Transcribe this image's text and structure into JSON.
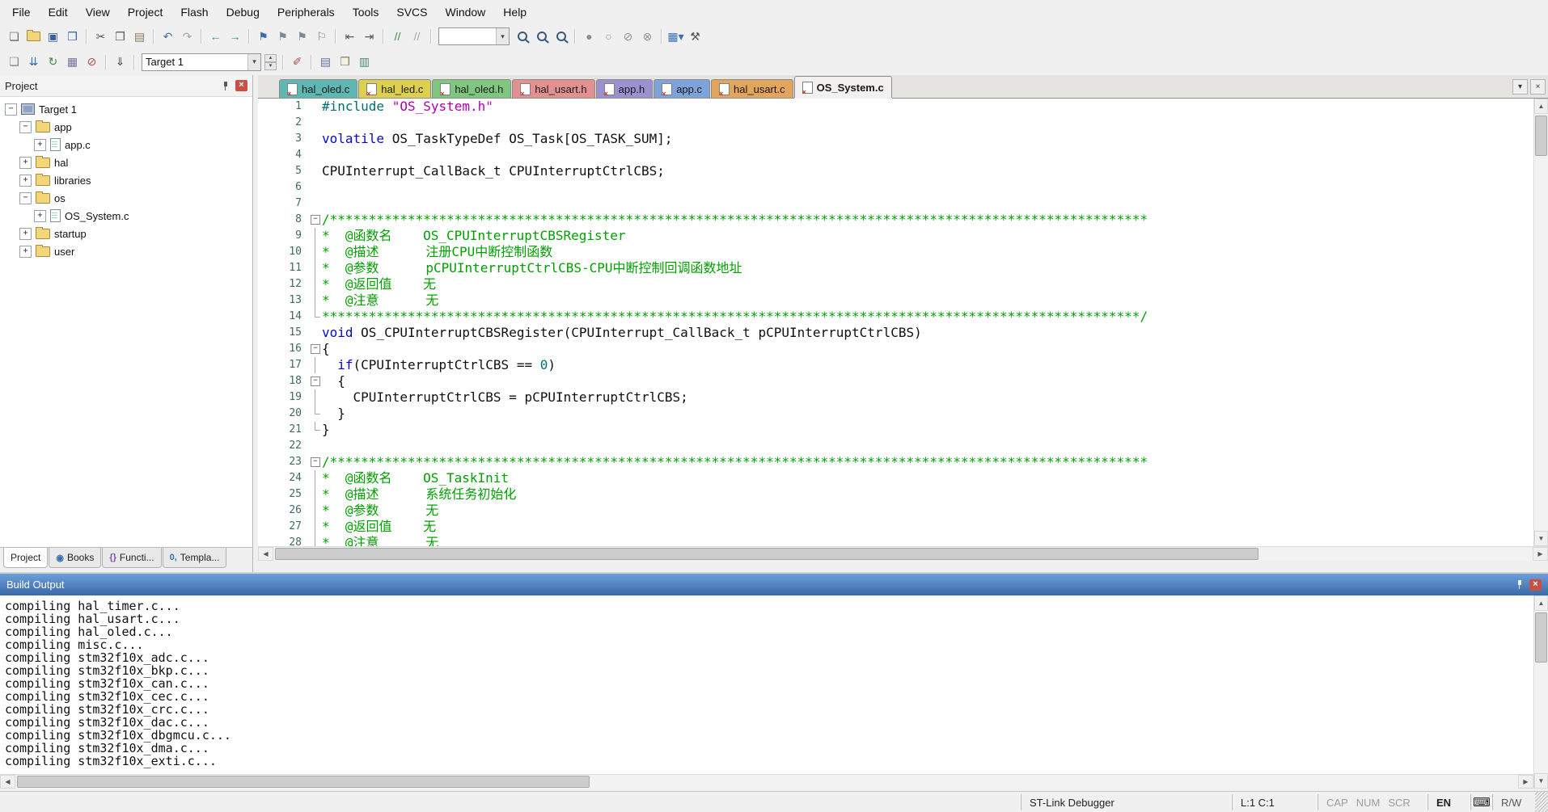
{
  "menubar": {
    "items": [
      "File",
      "Edit",
      "View",
      "Project",
      "Flash",
      "Debug",
      "Peripherals",
      "Tools",
      "SVCS",
      "Window",
      "Help"
    ]
  },
  "toolbar1": {
    "items": [
      {
        "name": "new-file-icon",
        "glyph": "❏",
        "color": "#5a6a7a"
      },
      {
        "name": "open-file-icon",
        "type": "folder"
      },
      {
        "name": "save-icon",
        "glyph": "▣",
        "color": "#3a5fa0"
      },
      {
        "name": "save-all-icon",
        "glyph": "❒",
        "color": "#3a5fa0"
      },
      {
        "type": "sep"
      },
      {
        "name": "cut-icon",
        "glyph": "✂",
        "color": "#555555"
      },
      {
        "name": "copy-icon",
        "glyph": "❐",
        "color": "#555555"
      },
      {
        "name": "paste-icon",
        "glyph": "▤",
        "color": "#8a7a5a"
      },
      {
        "type": "sep"
      },
      {
        "name": "undo-icon",
        "glyph": "↶",
        "color": "#3a6fb0"
      },
      {
        "name": "redo-icon",
        "glyph": "↷",
        "color": "#9aa4b0"
      },
      {
        "type": "sep"
      },
      {
        "name": "navigate-back-icon",
        "glyph": "←",
        "color": "#2a9a9a"
      },
      {
        "name": "navigate-forward-icon",
        "glyph": "→",
        "color": "#2a9a9a"
      },
      {
        "type": "sep"
      },
      {
        "name": "bookmark-toggle-icon",
        "glyph": "⚑",
        "color": "#3a6fb0"
      },
      {
        "name": "bookmark-prev-icon",
        "glyph": "⚑",
        "color": "#7a8a9a"
      },
      {
        "name": "bookmark-next-icon",
        "glyph": "⚑",
        "color": "#7a8a9a"
      },
      {
        "name": "bookmark-clear-icon",
        "glyph": "⚐",
        "color": "#7a8a9a"
      },
      {
        "type": "sep"
      },
      {
        "name": "unindent-icon",
        "glyph": "⇤",
        "color": "#555555"
      },
      {
        "name": "indent-icon",
        "glyph": "⇥",
        "color": "#555555"
      },
      {
        "type": "sep"
      },
      {
        "name": "comment-icon",
        "glyph": "//",
        "color": "#3a8a3a"
      },
      {
        "name": "uncomment-icon",
        "glyph": "//",
        "color": "#9aa6b0"
      },
      {
        "type": "sep"
      },
      {
        "type": "combo",
        "name": "quick-search-combo",
        "value": ""
      },
      {
        "name": "find-in-files-icon",
        "type": "mag"
      },
      {
        "name": "find-icon",
        "type": "mag"
      },
      {
        "name": "incremental-find-icon",
        "type": "mag"
      },
      {
        "type": "sep"
      },
      {
        "name": "insert-breakpoint-icon",
        "glyph": "●",
        "color": "#8f8f8f"
      },
      {
        "name": "enable-breakpoint-icon",
        "glyph": "○",
        "color": "#8f8f8f"
      },
      {
        "name": "disable-all-breakpoints-icon",
        "glyph": "⊘",
        "color": "#8f8f8f"
      },
      {
        "name": "kill-all-breakpoints-icon",
        "glyph": "⊗",
        "color": "#8f8f8f"
      },
      {
        "type": "sep"
      },
      {
        "name": "debug-windows-dropdown-icon",
        "glyph": "▦▾",
        "color": "#3a6fb0"
      },
      {
        "name": "configure-icon",
        "glyph": "⚒",
        "color": "#555555"
      }
    ]
  },
  "toolbar2": {
    "items": [
      {
        "name": "translate-file-icon",
        "glyph": "❏",
        "color": "#7a8a9a"
      },
      {
        "name": "build-icon",
        "glyph": "⇊",
        "color": "#3a6fb0"
      },
      {
        "name": "rebuild-all-icon",
        "glyph": "↻",
        "color": "#3a8a4a"
      },
      {
        "name": "batch-build-icon",
        "glyph": "▦",
        "color": "#7a6f9f"
      },
      {
        "name": "stop-build-icon",
        "glyph": "⊘",
        "color": "#b04848"
      },
      {
        "type": "sep"
      },
      {
        "name": "download-icon",
        "glyph": "⇓",
        "color": "#4a4a4a"
      },
      {
        "type": "sep"
      },
      {
        "type": "combo",
        "name": "target-select",
        "value": "Target 1",
        "wide": 146
      },
      {
        "type": "spin",
        "name": "target-spin"
      },
      {
        "type": "sep"
      },
      {
        "name": "options-for-target-icon",
        "glyph": "✐",
        "color": "#b05050"
      },
      {
        "type": "sep"
      },
      {
        "name": "file-extensions-icon",
        "glyph": "▤",
        "color": "#5a6fa0"
      },
      {
        "name": "books-environment-icon",
        "glyph": "❒",
        "color": "#8a7f4f"
      },
      {
        "name": "manage-rte-icon",
        "glyph": "▥",
        "color": "#4f8a6f"
      }
    ]
  },
  "project_panel": {
    "title": "Project",
    "close_glyph": "×",
    "tree": [
      {
        "label": "Target 1",
        "level": 0,
        "expand": "minus",
        "icon": "target"
      },
      {
        "label": "app",
        "level": 1,
        "expand": "minus",
        "icon": "folder"
      },
      {
        "label": "app.c",
        "level": 2,
        "expand": "plus",
        "icon": "file"
      },
      {
        "label": "hal",
        "level": 1,
        "expand": "plus",
        "icon": "folder"
      },
      {
        "label": "libraries",
        "level": 1,
        "expand": "plus",
        "icon": "folder"
      },
      {
        "label": "os",
        "level": 1,
        "expand": "minus",
        "icon": "folder"
      },
      {
        "label": "OS_System.c",
        "level": 2,
        "expand": "plus",
        "icon": "file"
      },
      {
        "label": "startup",
        "level": 1,
        "expand": "plus",
        "icon": "folder"
      },
      {
        "label": "user",
        "level": 1,
        "expand": "plus",
        "icon": "folder"
      }
    ],
    "bottom_tabs": [
      {
        "label": "Project",
        "active": true,
        "glyph": "",
        "color": ""
      },
      {
        "label": "Books",
        "glyph": "◉",
        "color": "#3a6fb0"
      },
      {
        "label": "Functi...",
        "glyph": "{}",
        "color": "#7a4fb0"
      },
      {
        "label": "Templa...",
        "glyph": "0,",
        "color": "#3a6fb0"
      }
    ]
  },
  "editor": {
    "tab_controls": {
      "dropdown": "▾",
      "close": "×"
    },
    "tabs": [
      {
        "label": "hal_oled.c",
        "color": "#5fb7b1"
      },
      {
        "label": "hal_led.c",
        "color": "#ded04f"
      },
      {
        "label": "hal_oled.h",
        "color": "#7fc77e"
      },
      {
        "label": "hal_usart.h",
        "color": "#e29090"
      },
      {
        "label": "app.h",
        "color": "#9b90d0"
      },
      {
        "label": "app.c",
        "color": "#7ea3da"
      },
      {
        "label": "hal_usart.c",
        "color": "#e2a55e"
      },
      {
        "label": "OS_System.c",
        "color": "#f2f1ef",
        "active": true
      }
    ],
    "lines": [
      {
        "n": 1,
        "fold": "",
        "segs": [
          [
            "pp",
            "#include "
          ],
          [
            "str",
            "\"OS_System.h\""
          ]
        ]
      },
      {
        "n": 2,
        "fold": "",
        "segs": []
      },
      {
        "n": 3,
        "fold": "",
        "segs": [
          [
            "kw",
            "volatile"
          ],
          [
            "plain",
            " OS_TaskTypeDef OS_Task[OS_TASK_SUM];"
          ]
        ]
      },
      {
        "n": 4,
        "fold": "",
        "segs": []
      },
      {
        "n": 5,
        "fold": "",
        "segs": [
          [
            "plain",
            "CPUInterrupt_CallBack_t CPUInterruptCtrlCBS;"
          ]
        ]
      },
      {
        "n": 6,
        "fold": "",
        "segs": []
      },
      {
        "n": 7,
        "fold": "",
        "segs": []
      },
      {
        "n": 8,
        "fold": "minus",
        "segs": [
          [
            "cmt",
            "/*********************************************************************************************************"
          ]
        ]
      },
      {
        "n": 9,
        "fold": "line",
        "segs": [
          [
            "cmt",
            "*  @函数名    OS_CPUInterruptCBSRegister"
          ]
        ]
      },
      {
        "n": 10,
        "fold": "line",
        "segs": [
          [
            "cmt",
            "*  @描述      注册CPU中断控制函数"
          ]
        ]
      },
      {
        "n": 11,
        "fold": "line",
        "segs": [
          [
            "cmt",
            "*  @参数      pCPUInterruptCtrlCBS-CPU中断控制回调函数地址"
          ]
        ]
      },
      {
        "n": 12,
        "fold": "line",
        "segs": [
          [
            "cmt",
            "*  @返回值    无"
          ]
        ]
      },
      {
        "n": 13,
        "fold": "line",
        "segs": [
          [
            "cmt",
            "*  @注意      无"
          ]
        ]
      },
      {
        "n": 14,
        "fold": "end",
        "segs": [
          [
            "cmt",
            "*********************************************************************************************************/"
          ]
        ]
      },
      {
        "n": 15,
        "fold": "",
        "segs": [
          [
            "kw",
            "void"
          ],
          [
            "plain",
            " OS_CPUInterruptCBSRegister(CPUInterrupt_CallBack_t pCPUInterruptCtrlCBS)"
          ]
        ]
      },
      {
        "n": 16,
        "fold": "minus",
        "segs": [
          [
            "plain",
            "{"
          ]
        ]
      },
      {
        "n": 17,
        "fold": "line",
        "segs": [
          [
            "plain",
            "  "
          ],
          [
            "kw",
            "if"
          ],
          [
            "plain",
            "(CPUInterruptCtrlCBS == "
          ],
          [
            "num",
            "0"
          ],
          [
            "plain",
            ")"
          ]
        ]
      },
      {
        "n": 18,
        "fold": "minus",
        "segs": [
          [
            "plain",
            "  {"
          ]
        ]
      },
      {
        "n": 19,
        "fold": "line",
        "segs": [
          [
            "plain",
            "    CPUInterruptCtrlCBS = pCPUInterruptCtrlCBS;"
          ]
        ]
      },
      {
        "n": 20,
        "fold": "end",
        "segs": [
          [
            "plain",
            "  }"
          ]
        ]
      },
      {
        "n": 21,
        "fold": "end",
        "segs": [
          [
            "plain",
            "}"
          ]
        ]
      },
      {
        "n": 22,
        "fold": "",
        "segs": []
      },
      {
        "n": 23,
        "fold": "minus",
        "segs": [
          [
            "cmt",
            "/*********************************************************************************************************"
          ]
        ]
      },
      {
        "n": 24,
        "fold": "line",
        "segs": [
          [
            "cmt",
            "*  @函数名    OS_TaskInit"
          ]
        ]
      },
      {
        "n": 25,
        "fold": "line",
        "segs": [
          [
            "cmt",
            "*  @描述      系统任务初始化"
          ]
        ]
      },
      {
        "n": 26,
        "fold": "line",
        "segs": [
          [
            "cmt",
            "*  @参数      无"
          ]
        ]
      },
      {
        "n": 27,
        "fold": "line",
        "segs": [
          [
            "cmt",
            "*  @返回值    无"
          ]
        ]
      },
      {
        "n": 28,
        "fold": "line",
        "segs": [
          [
            "cmt",
            "*  @注意      无"
          ]
        ]
      }
    ]
  },
  "build_output": {
    "title": "Build Output",
    "close_glyph": "×",
    "lines": [
      "compiling hal_timer.c...",
      "compiling hal_usart.c...",
      "compiling hal_oled.c...",
      "compiling misc.c...",
      "compiling stm32f10x_adc.c...",
      "compiling stm32f10x_bkp.c...",
      "compiling stm32f10x_can.c...",
      "compiling stm32f10x_cec.c...",
      "compiling stm32f10x_crc.c...",
      "compiling stm32f10x_dac.c...",
      "compiling stm32f10x_dbgmcu.c...",
      "compiling stm32f10x_dma.c...",
      "compiling stm32f10x_exti.c..."
    ]
  },
  "statusbar": {
    "debugger": "ST-Link Debugger",
    "cursor_position": "L:1 C:1",
    "cap": "CAP",
    "num": "NUM",
    "scr": "SCR",
    "lang": "EN",
    "kbd_glyph": "⌨",
    "readwrite": "R/W"
  }
}
